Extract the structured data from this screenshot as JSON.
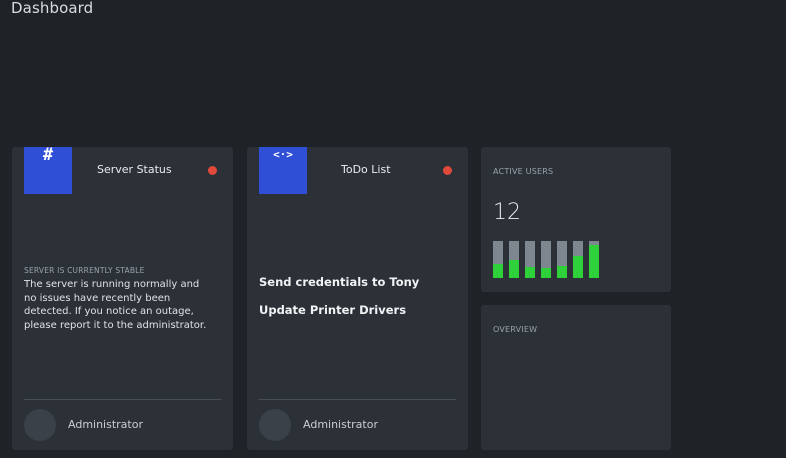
{
  "header": {
    "title": "Dashboard"
  },
  "server_card": {
    "title": "Server Status",
    "icon": "hash-icon",
    "icon_glyph": "#",
    "status_color": "#e0493a",
    "status_heading": "SERVER IS CURRENTLY STABLE",
    "status_body": "The server is running normally and no issues have recently been detected. If you notice an outage, please report it to the administrator.",
    "user": "Administrator"
  },
  "todo_card": {
    "title": "ToDo List",
    "icon": "code-icon",
    "icon_glyph": "<·>",
    "status_color": "#e0493a",
    "items": [
      "Send credentials to Tony",
      "Update Printer Drivers"
    ],
    "user": "Administrator"
  },
  "active_users_card": {
    "heading": "ACTIVE USERS",
    "value": "12",
    "bar_levels": [
      0.38,
      0.48,
      0.3,
      0.27,
      0.32,
      0.6,
      0.9
    ],
    "bar_colors": {
      "track": "#7e8790",
      "fill": "#2ed13a"
    }
  },
  "overview_card": {
    "heading": "OVERVIEW"
  },
  "colors": {
    "accent": "#2f4fd6",
    "background": "#1f2327",
    "card": "#2b3137"
  }
}
